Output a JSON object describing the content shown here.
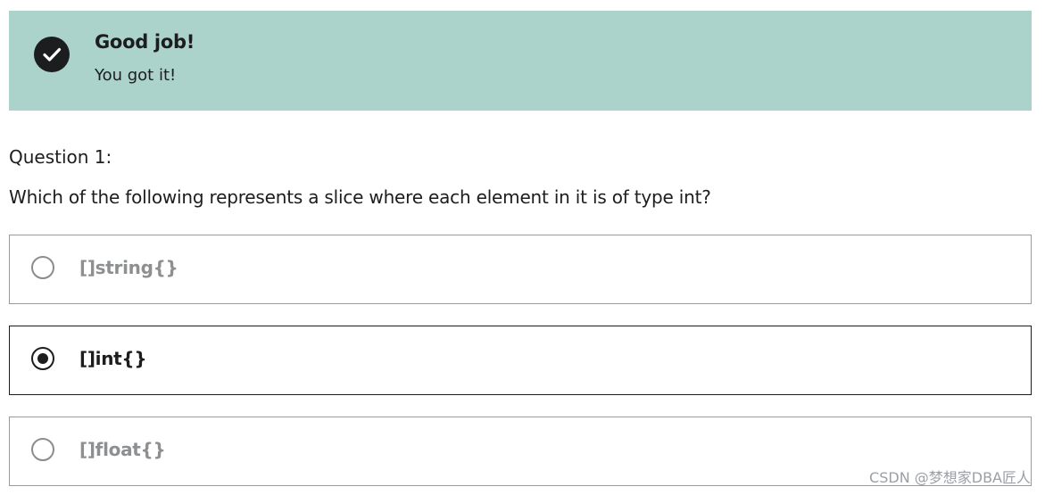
{
  "banner": {
    "icon": "check-circle-icon",
    "title": "Good job!",
    "subtitle": "You got it!",
    "background_color": "#acd2cc"
  },
  "question": {
    "label": "Question 1:",
    "prompt": "Which of the following represents a slice where each element in it is of type int?"
  },
  "options": [
    {
      "label": "[]string{}",
      "selected": false
    },
    {
      "label": "[]int{}",
      "selected": true
    },
    {
      "label": "[]float{}",
      "selected": false
    }
  ],
  "watermark": "CSDN @梦想家DBA匠人"
}
